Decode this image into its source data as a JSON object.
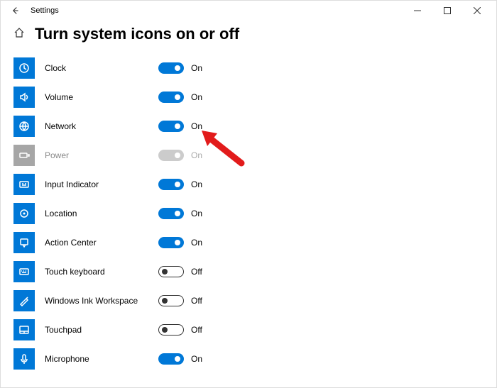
{
  "titlebar": {
    "app": "Settings"
  },
  "page": {
    "title": "Turn system icons on or off"
  },
  "stateLabels": {
    "on": "On",
    "off": "Off"
  },
  "items": [
    {
      "id": "clock",
      "label": "Clock",
      "on": true,
      "disabled": false,
      "icon": "clock"
    },
    {
      "id": "volume",
      "label": "Volume",
      "on": true,
      "disabled": false,
      "icon": "volume"
    },
    {
      "id": "network",
      "label": "Network",
      "on": true,
      "disabled": false,
      "icon": "network"
    },
    {
      "id": "power",
      "label": "Power",
      "on": true,
      "disabled": true,
      "icon": "power"
    },
    {
      "id": "input",
      "label": "Input Indicator",
      "on": true,
      "disabled": false,
      "icon": "input"
    },
    {
      "id": "location",
      "label": "Location",
      "on": true,
      "disabled": false,
      "icon": "location"
    },
    {
      "id": "action",
      "label": "Action Center",
      "on": true,
      "disabled": false,
      "icon": "action"
    },
    {
      "id": "touchkb",
      "label": "Touch keyboard",
      "on": false,
      "disabled": false,
      "icon": "keyboard"
    },
    {
      "id": "ink",
      "label": "Windows Ink Workspace",
      "on": false,
      "disabled": false,
      "icon": "ink"
    },
    {
      "id": "touchpad",
      "label": "Touchpad",
      "on": false,
      "disabled": false,
      "icon": "touchpad"
    },
    {
      "id": "mic",
      "label": "Microphone",
      "on": true,
      "disabled": false,
      "icon": "mic"
    }
  ]
}
